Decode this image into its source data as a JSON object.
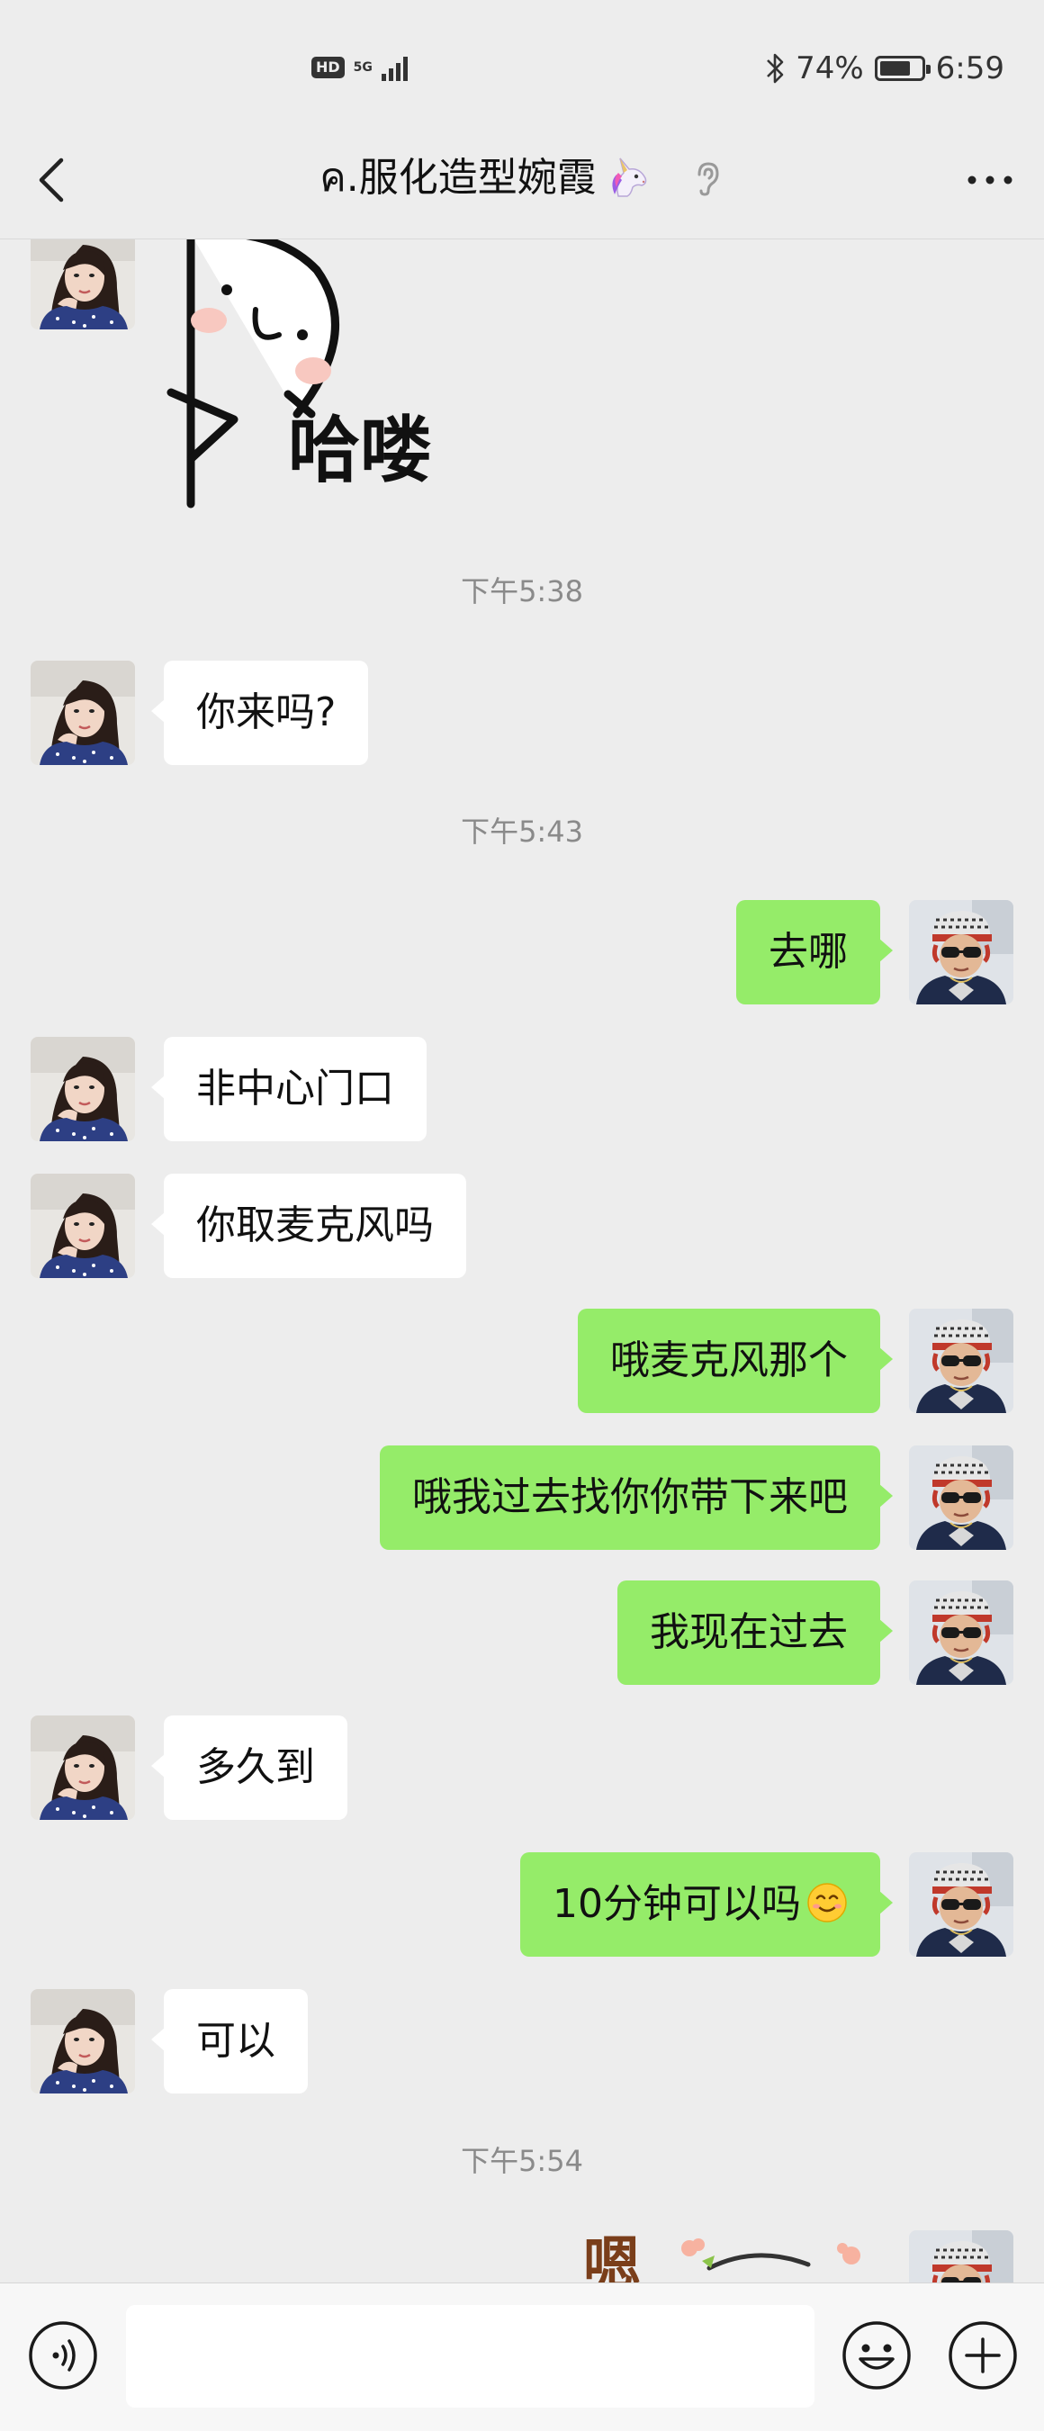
{
  "status_bar": {
    "hd": "HD",
    "network": "5G",
    "battery_percent": "74%",
    "battery_level": 0.74,
    "time": "6:59"
  },
  "header": {
    "title": "ค.服化造型婉霞",
    "back_icon": "chevron-left-icon",
    "more_icon": "more-dots-icon"
  },
  "messages": [
    {
      "type": "sticker",
      "side": "left",
      "text": "哈喽"
    },
    {
      "type": "timestamp",
      "text": "下午5:38"
    },
    {
      "type": "text",
      "side": "left",
      "text": "你来吗?"
    },
    {
      "type": "timestamp",
      "text": "下午5:43"
    },
    {
      "type": "text",
      "side": "right",
      "text": "去哪"
    },
    {
      "type": "text",
      "side": "left",
      "text": "非中心门口"
    },
    {
      "type": "text",
      "side": "left",
      "text": "你取麦克风吗"
    },
    {
      "type": "text",
      "side": "right",
      "text": "哦麦克风那个"
    },
    {
      "type": "text",
      "side": "right",
      "text": "哦我过去找你你带下来吧"
    },
    {
      "type": "text",
      "side": "right",
      "text": "我现在过去"
    },
    {
      "type": "text",
      "side": "left",
      "text": "多久到"
    },
    {
      "type": "text",
      "side": "right",
      "text": "10分钟可以吗",
      "emoji": "smiling-face-icon"
    },
    {
      "type": "text",
      "side": "left",
      "text": "可以"
    },
    {
      "type": "timestamp",
      "text": "下午5:54"
    },
    {
      "type": "sticker",
      "side": "right",
      "text": "嗯"
    }
  ],
  "input_bar": {
    "placeholder": "",
    "voice_icon": "voice-icon",
    "emoji_icon": "emoji-icon",
    "plus_icon": "plus-icon"
  }
}
